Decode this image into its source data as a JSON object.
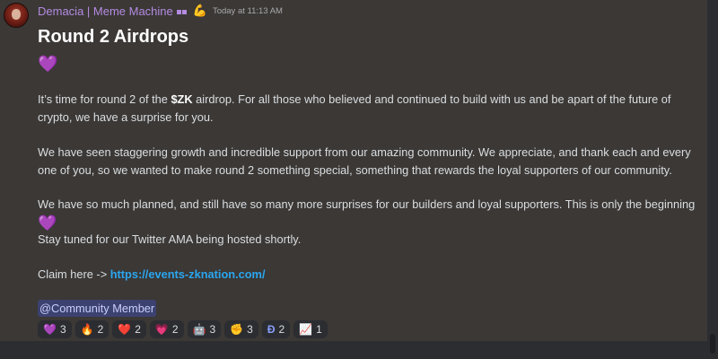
{
  "message": {
    "author": "Demacia | Meme Machine",
    "timestamp": "Today at 11:13 AM",
    "title": "Round 2 Airdrops",
    "heart": "💜",
    "p1_pre": "It’s time for round 2 of the ",
    "p1_bold": "$ZK",
    "p1_post": " airdrop. For all those who believed and continued to build with us and be apart of the future of crypto, we have a surprise for you.",
    "p2": "We have seen staggering growth and incredible support from our amazing community. We appreciate, and thank each and every one of you, so we wanted to make round 2 something special, something that rewards the loyal supporters of our community.",
    "p3": "We have so much planned, and still have so many more surprises for our builders and loyal supporters. This is only the beginning",
    "p4": "Stay tuned for our Twitter AMA being hosted shortly.",
    "p5_pre": "Claim here -> ",
    "link": "https://events-zknation.com/",
    "mention": "@Community Member"
  },
  "reactions": [
    {
      "icon": "purple-heart-icon",
      "emoji": "💜",
      "count": "3"
    },
    {
      "icon": "fire-icon",
      "emoji": "🔥",
      "count": "2"
    },
    {
      "icon": "red-heart-icon",
      "emoji": "❤️",
      "count": "2"
    },
    {
      "icon": "heart-outline-icon",
      "emoji": "💗",
      "count": "2"
    },
    {
      "icon": "robot-icon",
      "emoji": "🤖",
      "count": "3"
    },
    {
      "icon": "clap-icon",
      "emoji": "✊",
      "count": "3"
    },
    {
      "icon": "zk-logo-icon",
      "emoji": "Ð",
      "count": "2"
    },
    {
      "icon": "chart-icon",
      "emoji": "📈",
      "count": "1"
    }
  ],
  "colors": {
    "background": "#3b3836",
    "username": "#b48be0",
    "link": "#2aa6f0",
    "mention_bg": "#3c4270"
  }
}
